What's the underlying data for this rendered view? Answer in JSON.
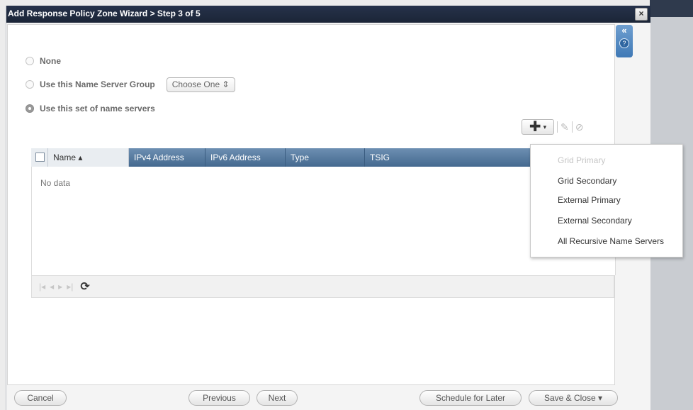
{
  "dialog": {
    "title": "Add Response Policy Zone Wizard > Step 3 of 5",
    "close_symbol": "×"
  },
  "side_tab": {
    "collapse_symbol": "«",
    "help_symbol": "?"
  },
  "options": {
    "none_label": "None",
    "group_label": "Use this Name Server Group",
    "group_select_value": "Choose One ⇕",
    "set_label": "Use this set of name servers"
  },
  "toolbar": {
    "add_symbol": "✚",
    "caret_symbol": "▾",
    "edit_symbol": "✎",
    "delete_symbol": "⊘"
  },
  "grid": {
    "columns": [
      "Name ▴",
      "IPv4 Address",
      "IPv6 Address",
      "Type",
      "TSIG"
    ],
    "empty_text": "No data",
    "pager_symbols": [
      "|◂",
      "◂",
      "▸",
      "▸|"
    ],
    "refresh_symbol": "⟳"
  },
  "add_menu": {
    "items": [
      {
        "label": "Grid Primary",
        "enabled": false
      },
      {
        "label": "Grid Secondary",
        "enabled": true
      },
      {
        "label": "External Primary",
        "enabled": true
      },
      {
        "label": "External Secondary",
        "enabled": true
      },
      {
        "label": "All Recursive Name Servers",
        "enabled": true
      }
    ]
  },
  "footer": {
    "cancel": "Cancel",
    "previous": "Previous",
    "next": "Next",
    "schedule": "Schedule for Later",
    "save_close": "Save & Close ▾"
  }
}
